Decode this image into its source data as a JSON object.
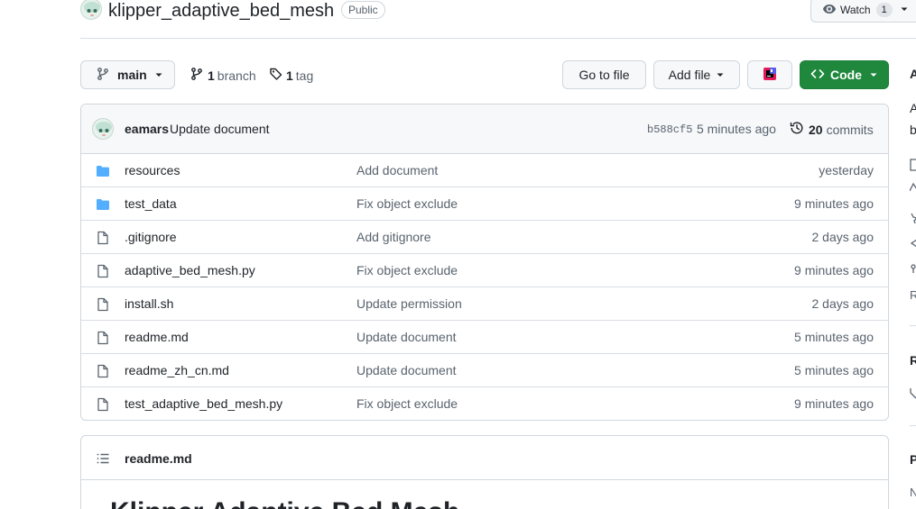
{
  "header": {
    "repo_name": "klipper_adaptive_bed_mesh",
    "visibility": "Public",
    "watch_label": "Watch",
    "watch_count": "1"
  },
  "toolbar": {
    "branch_name": "main",
    "branch_count": "1",
    "branch_label": "branch",
    "tag_count": "1",
    "tag_label": "tag",
    "goto_file_label": "Go to file",
    "add_file_label": "Add file",
    "code_label": "Code"
  },
  "latest_commit": {
    "author": "eamars",
    "message": "Update document",
    "sha": "b588cf5",
    "time": "5 minutes ago",
    "commit_count": "20",
    "commit_label": "commits"
  },
  "files": [
    {
      "type": "folder",
      "name": "resources",
      "message": "Add document",
      "time": "yesterday"
    },
    {
      "type": "folder",
      "name": "test_data",
      "message": "Fix object exclude",
      "time": "9 minutes ago"
    },
    {
      "type": "file",
      "name": ".gitignore",
      "message": "Add gitignore",
      "time": "2 days ago"
    },
    {
      "type": "file",
      "name": "adaptive_bed_mesh.py",
      "message": "Fix object exclude",
      "time": "9 minutes ago"
    },
    {
      "type": "file",
      "name": "install.sh",
      "message": "Update permission",
      "time": "2 days ago"
    },
    {
      "type": "file",
      "name": "readme.md",
      "message": "Update document",
      "time": "5 minutes ago"
    },
    {
      "type": "file",
      "name": "readme_zh_cn.md",
      "message": "Update document",
      "time": "5 minutes ago"
    },
    {
      "type": "file",
      "name": "test_adaptive_bed_mesh.py",
      "message": "Fix object exclude",
      "time": "9 minutes ago"
    }
  ],
  "readme": {
    "title": "readme.md",
    "heading": "Klipper Adaptive Bed Mesh"
  },
  "sidebar_peek": {
    "about": "A",
    "desc_1": "A",
    "desc_2": "b",
    "item_r": "R",
    "releases": "R",
    "packages": "P",
    "packages_sub": "N"
  },
  "colors": {
    "code_button": "#1f883d",
    "folder_icon": "#54aeff",
    "border": "#d0d7de",
    "muted_text": "#59636e"
  }
}
